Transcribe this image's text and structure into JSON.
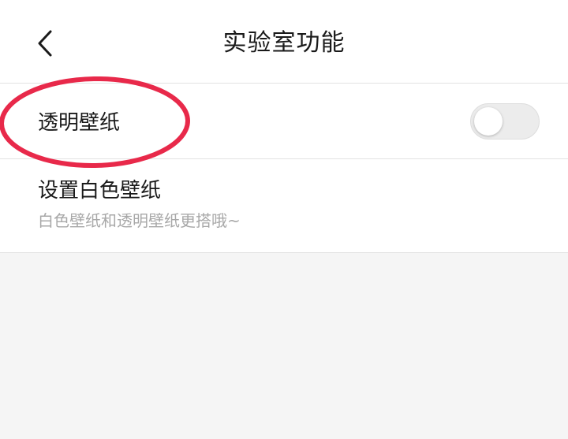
{
  "header": {
    "title": "实验室功能",
    "back_icon": "chevron-left-icon"
  },
  "settings": [
    {
      "title": "透明壁纸",
      "toggle": {
        "on": false
      }
    },
    {
      "title": "设置白色壁纸",
      "subtitle": "白色壁纸和透明壁纸更搭哦~"
    }
  ],
  "colors": {
    "annotation": "#e8294a",
    "background": "#f5f5f5",
    "surface": "#ffffff",
    "text_primary": "#1a1a1a",
    "text_secondary": "#a8a8a8",
    "toggle_off": "#ececec"
  }
}
